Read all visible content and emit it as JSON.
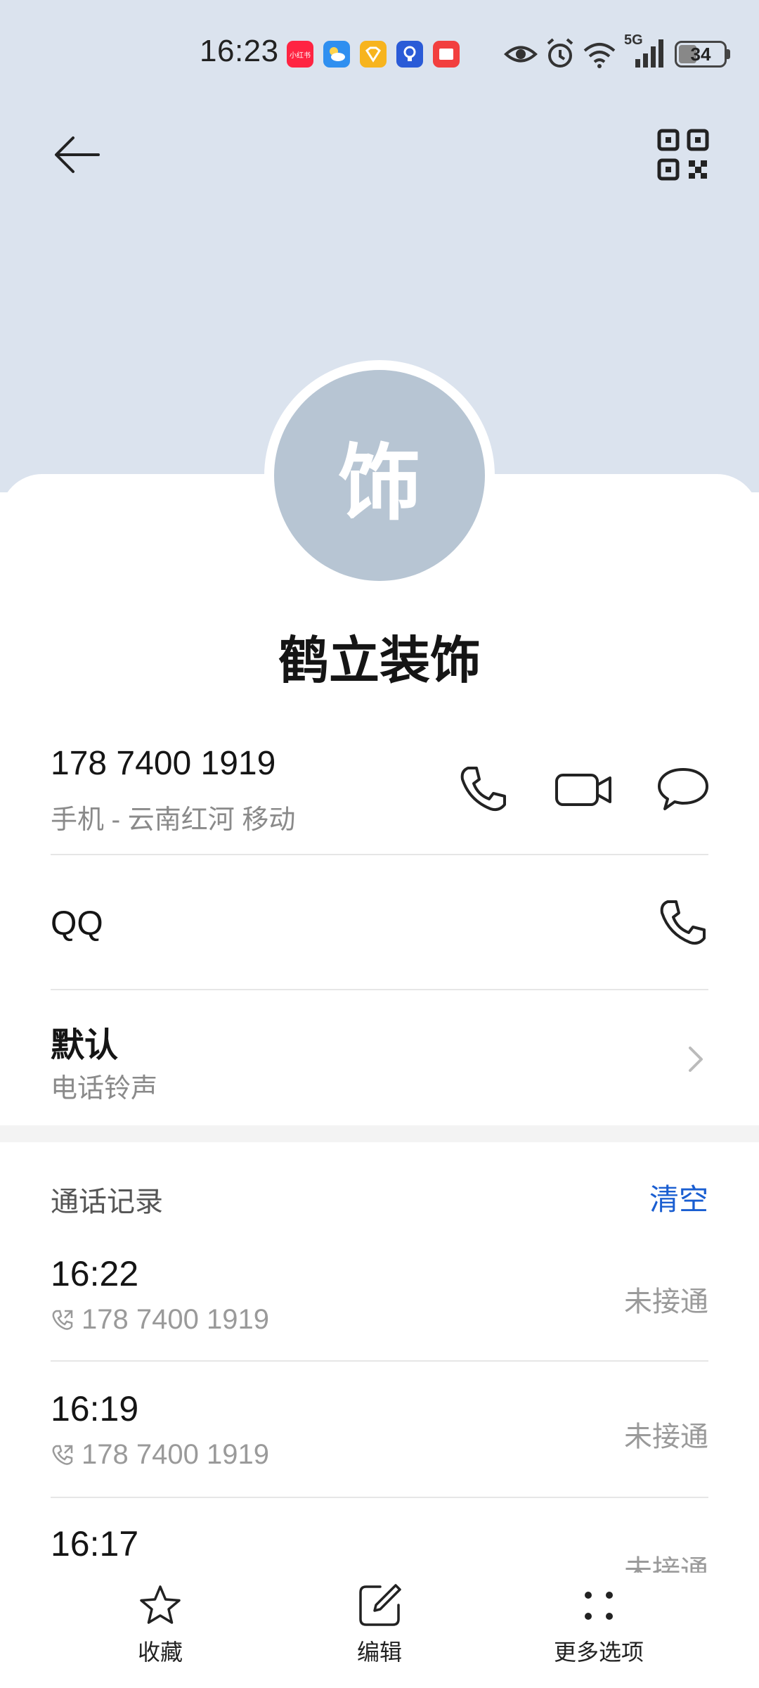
{
  "status_bar": {
    "time": "16:23",
    "battery": "34",
    "network": "5G",
    "app_icons": [
      {
        "name": "xiaohongshu-icon",
        "color": "#ff2442",
        "text": "小红书"
      },
      {
        "name": "weather-icon",
        "color": "#2f8ff0"
      },
      {
        "name": "vip-icon",
        "color": "#f7b41e"
      },
      {
        "name": "bulb-app-icon",
        "color": "#2a5bd7"
      },
      {
        "name": "reader-app-icon",
        "color": "#f23f3f"
      }
    ]
  },
  "contact": {
    "avatar_char": "饰",
    "name": "鹤立装饰",
    "phone": "178 7400 1919",
    "phone_sub": "手机 - 云南红河 移动",
    "qq_label": "QQ",
    "ringtone_value": "默认",
    "ringtone_label": "电话铃声"
  },
  "call_log": {
    "title": "通话记录",
    "clear_label": "清空",
    "entries": [
      {
        "time": "16:22",
        "number": "178 7400 1919",
        "status": "未接通"
      },
      {
        "time": "16:19",
        "number": "178 7400 1919",
        "status": "未接通"
      },
      {
        "time": "16:17",
        "number": "",
        "status": "未接通"
      }
    ]
  },
  "bottom_bar": {
    "favorite_label": "收藏",
    "edit_label": "编辑",
    "more_label": "更多选项"
  },
  "colors": {
    "header_bg": "#dbe3ee",
    "avatar_bg": "#b7c5d3",
    "accent": "#1a5ed1"
  }
}
